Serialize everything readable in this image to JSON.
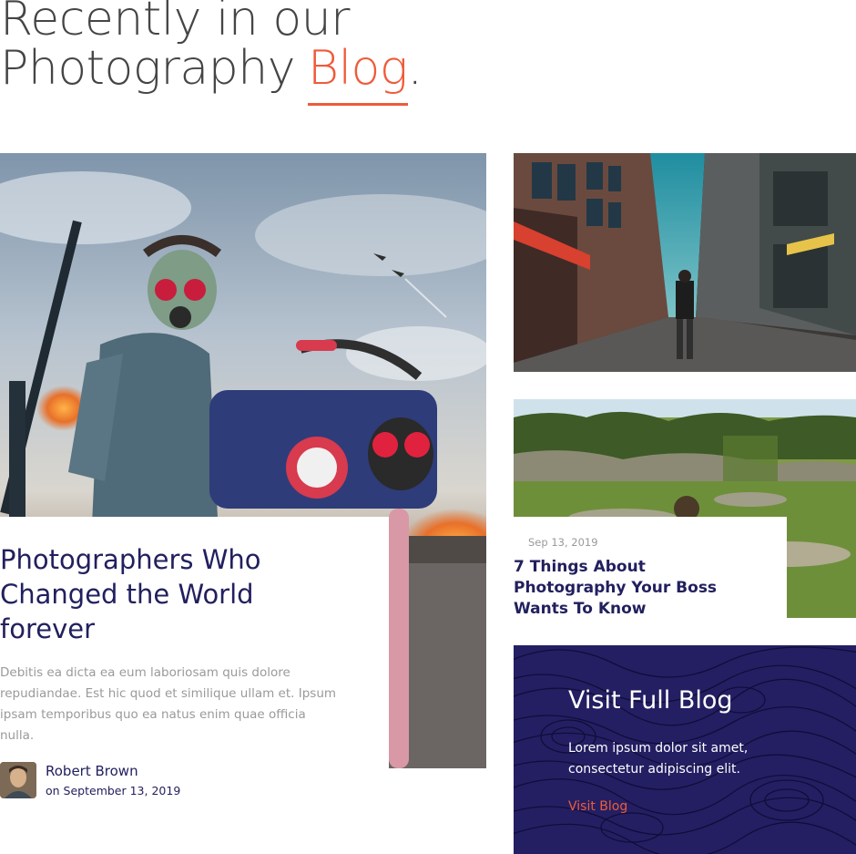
{
  "heading": {
    "line1": "Recently in our",
    "line2": "Photography",
    "accent": "Blog",
    "dot": "."
  },
  "main_post": {
    "title": "Photographers Who Changed the World forever",
    "excerpt": "Debitis ea dicta ea eum laboriosam quis dolore repudiandae. Est hic quod et similique ullam et. Ipsum ipsam temporibus quo ea natus enim quae officia nulla.",
    "author_name": "Robert Brown",
    "date": "on September 13, 2019"
  },
  "side_post": {
    "date": "Sep 13, 2019",
    "title": "7 Things About Photography Your Boss Wants To Know"
  },
  "cta": {
    "title": "Visit Full Blog",
    "text": "Lorem ipsum dolor sit amet, consectetur adipiscing elit.",
    "link": "Visit Blog"
  },
  "colors": {
    "accent": "#ee5b3b",
    "navy": "#22205e",
    "cta_bg": "#241f63"
  }
}
